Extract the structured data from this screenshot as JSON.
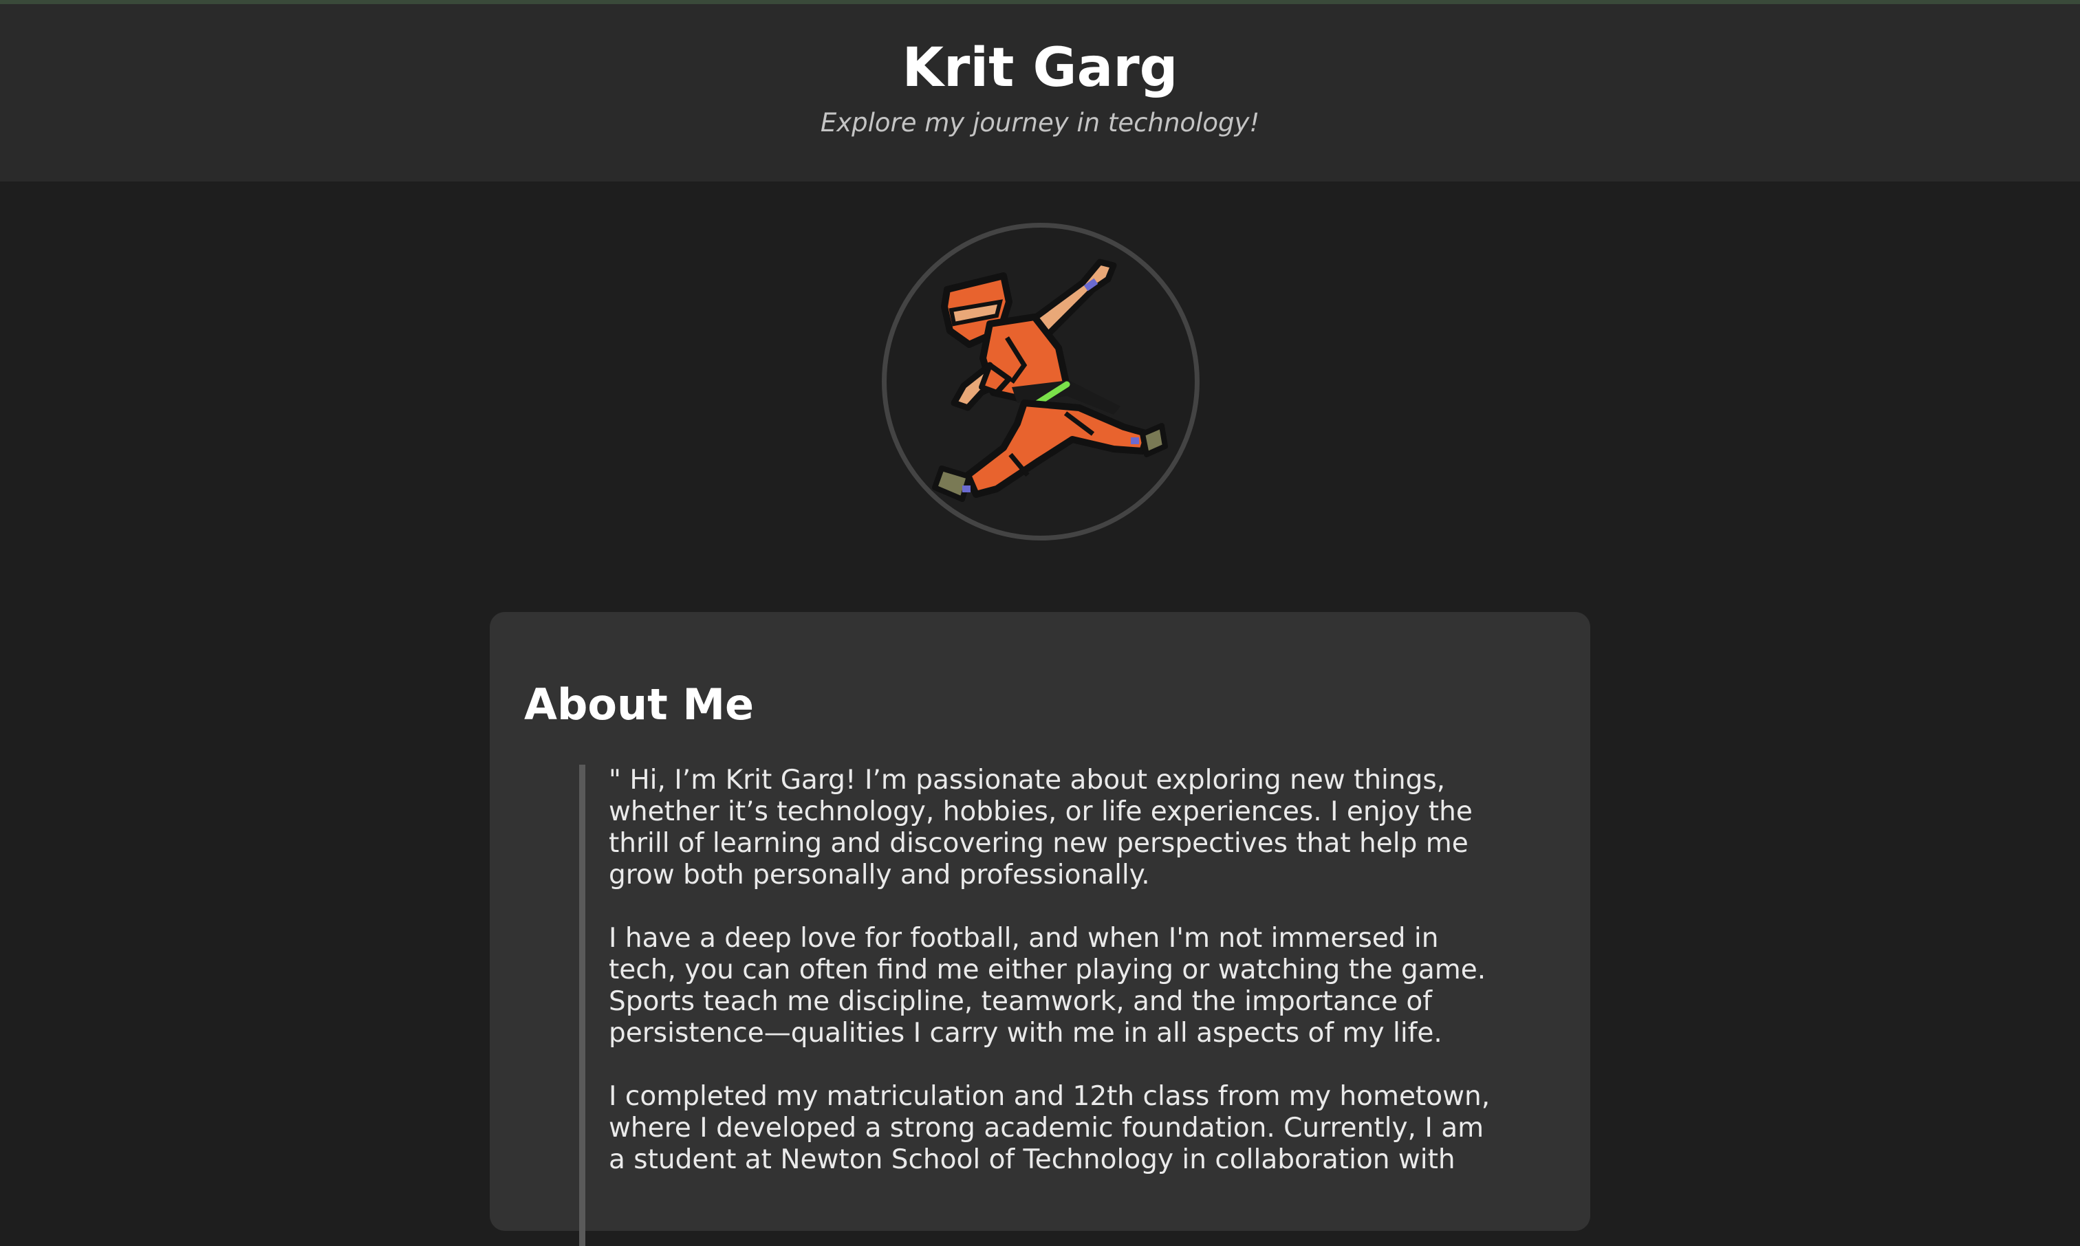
{
  "header": {
    "title": "Krit Garg",
    "tagline": "Explore my journey in technology!"
  },
  "avatar": {
    "icon": "ninja-avatar",
    "ring_color": "#444444",
    "gi_color": "#e8632e"
  },
  "about": {
    "heading": "About Me",
    "paragraphs": [
      "\" Hi, I’m Krit Garg! I’m passionate about exploring new things, whether it’s technology, hobbies, or life experiences. I enjoy the thrill of learning and discovering new perspectives that help me grow both personally and professionally.",
      "I have a deep love for football, and when I'm not immersed in tech, you can often find me either playing or watching the game. Sports teach me discipline, teamwork, and the importance of persistence—qualities I carry with me in all aspects of my life.",
      "I completed my matriculation and 12th class from my hometown, where I developed a strong academic foundation. Currently, I am a student at Newton School of Technology in collaboration with"
    ]
  },
  "colors": {
    "page_bg": "#1e1e1e",
    "header_bg": "#2a2a2a",
    "card_bg": "#333333",
    "quote_border": "#5a5a5a"
  }
}
